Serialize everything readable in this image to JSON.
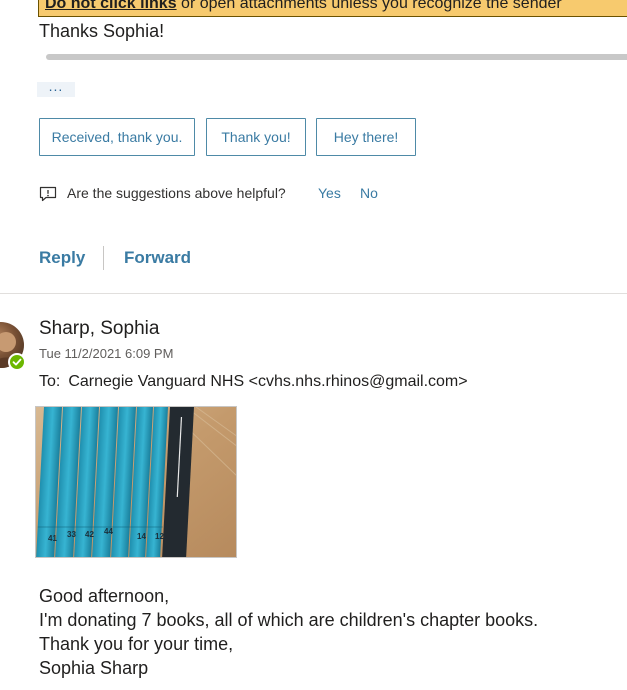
{
  "warning": {
    "bold_text": "Do not click links",
    "rest_text": " or open attachments unless you recognize the sender"
  },
  "previous_message": {
    "closing_text": "Thanks Sophia!",
    "more_label": "..."
  },
  "suggested_replies": [
    "Received, thank you.",
    "Thank you!",
    "Hey there!"
  ],
  "feedback": {
    "question": "Are the suggestions above helpful?",
    "yes_label": "Yes",
    "no_label": "No",
    "icon": "feedback-icon"
  },
  "actions": {
    "reply_label": "Reply",
    "forward_label": "Forward"
  },
  "message": {
    "sender": "Sharp, Sophia",
    "datetime": "Tue 11/2/2021 6:09 PM",
    "to_label": "To:",
    "recipient": "Carnegie Vanguard NHS <cvhs.nhs.rhinos@gmail.com>",
    "presence_status": "available",
    "attachment_book_labels": [
      "41",
      "33",
      "42",
      "44",
      "14",
      "12"
    ],
    "body": [
      "Good afternoon,",
      "I'm donating 7 books, all of which are children's chapter books.",
      "Thank you for your time,",
      "Sophia Sharp"
    ]
  },
  "colors": {
    "accent": "#3a7ba3",
    "warning_bg": "#f7ca6e",
    "presence": "#6bb700"
  }
}
